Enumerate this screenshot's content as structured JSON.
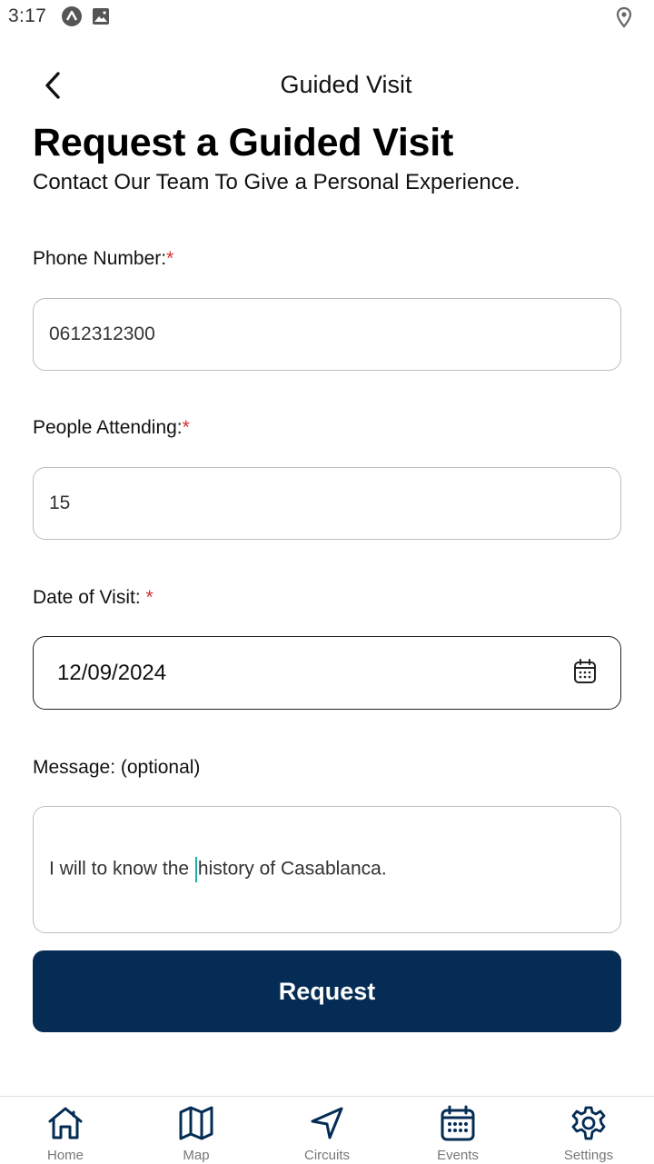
{
  "status_bar": {
    "time": "3:17"
  },
  "app_bar": {
    "title": "Guided Visit"
  },
  "form": {
    "heading": "Request a Guided Visit",
    "subheading": "Contact Our Team To Give a Personal Experience.",
    "phone": {
      "label": "Phone Number:",
      "value": "0612312300"
    },
    "people": {
      "label": "People Attending:",
      "value": "15"
    },
    "date": {
      "label": "Date of Visit: ",
      "value": "12/09/2024"
    },
    "message": {
      "label": "Message: (optional)",
      "value_before_caret": "I will to know the ",
      "value_after_caret": "history of Casablanca."
    },
    "required_mark": "*",
    "submit_label": "Request"
  },
  "bottom_nav": {
    "items": [
      {
        "label": "Home",
        "icon": "home-icon"
      },
      {
        "label": "Map",
        "icon": "map-icon"
      },
      {
        "label": "Circuits",
        "icon": "navigation-arrow-icon"
      },
      {
        "label": "Events",
        "icon": "calendar-icon"
      },
      {
        "label": "Settings",
        "icon": "gear-icon"
      }
    ]
  },
  "colors": {
    "primary": "#042c54",
    "required": "#d32f2f",
    "caret": "#17b3a3",
    "nav_label": "#777777"
  }
}
